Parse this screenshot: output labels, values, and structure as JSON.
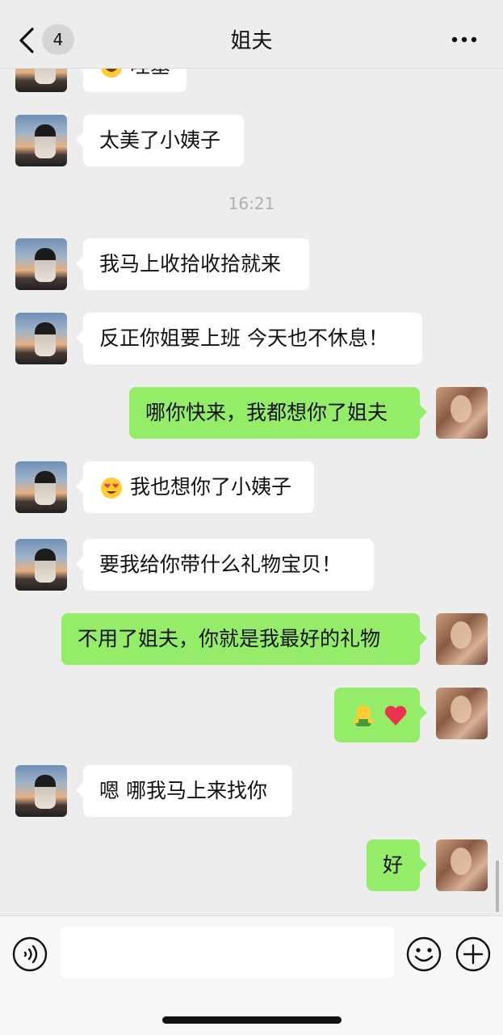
{
  "header": {
    "title": "姐夫",
    "unread_count": "4",
    "back_icon": "chevron-left-icon",
    "more_icon": "more-dots-icon"
  },
  "messages": [
    {
      "side": "in",
      "text": "哇塞",
      "emoji": "grinning-face-icon"
    },
    {
      "side": "in",
      "text": "太美了小姨子"
    },
    {
      "type": "time",
      "text": "16:21"
    },
    {
      "side": "in",
      "text": "我马上收拾收拾就来"
    },
    {
      "side": "in",
      "text": "反正你姐要上班 今天也不休息！"
    },
    {
      "side": "out",
      "text": "哪你快来，我都想你了姐夫"
    },
    {
      "side": "in",
      "text": "我也想你了小姨子",
      "emoji": "smiling-face-with-heart-eyes-icon"
    },
    {
      "side": "in",
      "text": "要我给你带什么礼物宝贝！"
    },
    {
      "side": "out",
      "text": "不用了姐夫，你就是我最好的礼物"
    },
    {
      "side": "out",
      "text": "",
      "emoji": "hug-and-heart-icons"
    },
    {
      "side": "in",
      "text": "嗯 哪我马上来找你"
    },
    {
      "side": "out",
      "text": "好"
    }
  ],
  "input_bar": {
    "voice_icon": "voice-icon",
    "emoji_icon": "emoji-icon",
    "plus_icon": "plus-icon",
    "text_value": ""
  },
  "colors": {
    "background": "#ededed",
    "outgoing_bubble": "#95ec69",
    "incoming_bubble": "#ffffff"
  }
}
